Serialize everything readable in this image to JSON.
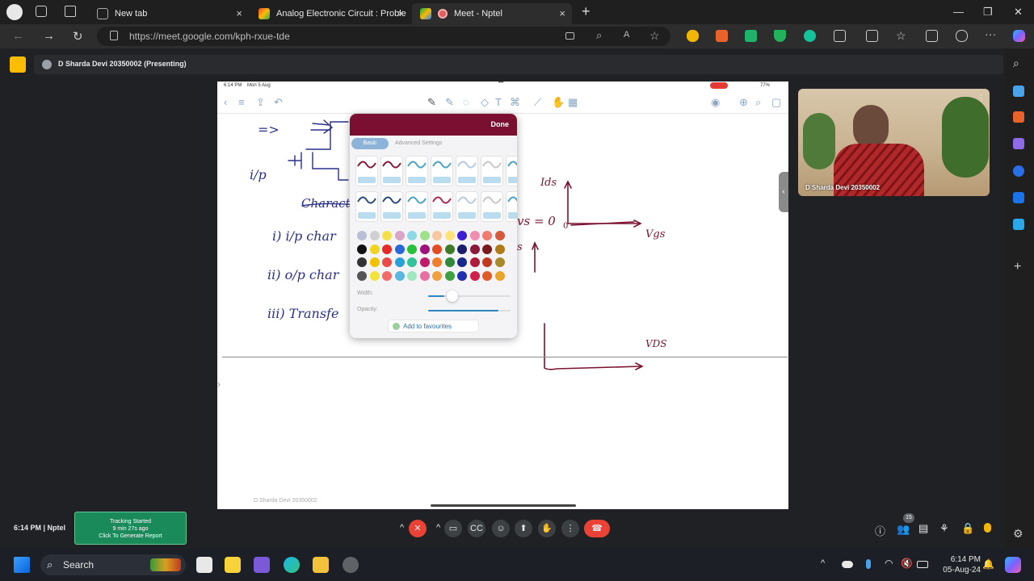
{
  "browser": {
    "tabs": [
      {
        "label": "New tab",
        "icon": "new-tab-icon"
      },
      {
        "label": "Analog Electronic Circuit : Proble",
        "icon": "gmail-icon"
      },
      {
        "label": "Meet - Nptel",
        "icon": "meet-icon"
      }
    ],
    "new_tab_glyph": "+",
    "url": "https://meet.google.com/kph-rxue-tde"
  },
  "meet": {
    "presenting_label": "D Sharda Devi 20350002 (Presenting)",
    "self_view_name": "D Sharda Devi 20350002",
    "time": "6:14 PM",
    "meeting_name": "Nptel",
    "people_count": "15"
  },
  "tracking": {
    "line1": "Tracking Started",
    "line2": "9 min 27s ago",
    "line3": "Click To Generate Report"
  },
  "ipad": {
    "status_time": "6:14 PM",
    "status_date": "Mon 5 Aug",
    "battery": "77%",
    "footer_name": "D Sharda Devi 20350002"
  },
  "notes": {
    "arrow": "=>",
    "ip": "i/p",
    "title": "Charact",
    "item1": "i) i/p char",
    "item2": "ii) o/p char",
    "item3": "iii) Transfe",
    "vgs_zero": "vs = 0",
    "ids": "Ids",
    "vgs_axis": "Vgs",
    "vds_axis": "VDS",
    "origin": "0",
    "stray": "s"
  },
  "pen_popover": {
    "done_label": "Done",
    "tab_basic": "Basic",
    "tab_advanced": "Advanced Settings",
    "width_label": "Width:",
    "opacity_label": "Opacity:",
    "width_value": 0.2,
    "opacity_value": 0.85,
    "favourites_label": "Add to favourites",
    "pen_colors": [
      "#8b1a3a",
      "#8b1a3a",
      "#4aa3c7",
      "#4aa3c7",
      "#b7c9df",
      "#c7c7c7",
      "#4aa3c7",
      "#2a4b7c",
      "#2a4b7c",
      "#4aa3c7",
      "#b4264e",
      "#b7c9df",
      "#c7c7c7",
      "#4aa3c7"
    ],
    "palette": [
      [
        "#b8c0d6",
        "#d0d0d0",
        "#f2e14b",
        "#d9a4c8",
        "#8ed8e8",
        "#9fe28c",
        "#f7c8a0",
        "#ffe27a",
        "#3b1fd1",
        "#f28db0",
        "#f07b6e",
        "#d35a3a"
      ],
      [
        "#111111",
        "#f2d41f",
        "#e32929",
        "#2a68d8",
        "#29c03a",
        "#a0107a",
        "#e34b24",
        "#3f7a2a",
        "#1c1c6e",
        "#8b1a3a",
        "#7a1a1a",
        "#b07a1a"
      ],
      [
        "#333333",
        "#f2c200",
        "#e84a4a",
        "#2aa0d8",
        "#31c49a",
        "#c01a6a",
        "#f07e2a",
        "#2f8a3a",
        "#162a8a",
        "#b01a3a",
        "#c03a20",
        "#a88a2a"
      ],
      [
        "#555555",
        "#f2e43a",
        "#f06a6a",
        "#58b8e0",
        "#a0e8c0",
        "#e870a0",
        "#f0a040",
        "#3ea040",
        "#2030b0",
        "#d0204a",
        "#e05a2a",
        "#e8a52a"
      ]
    ]
  },
  "windows": {
    "search_label": "Search",
    "time": "6:14 PM",
    "date": "05-Aug-24"
  }
}
